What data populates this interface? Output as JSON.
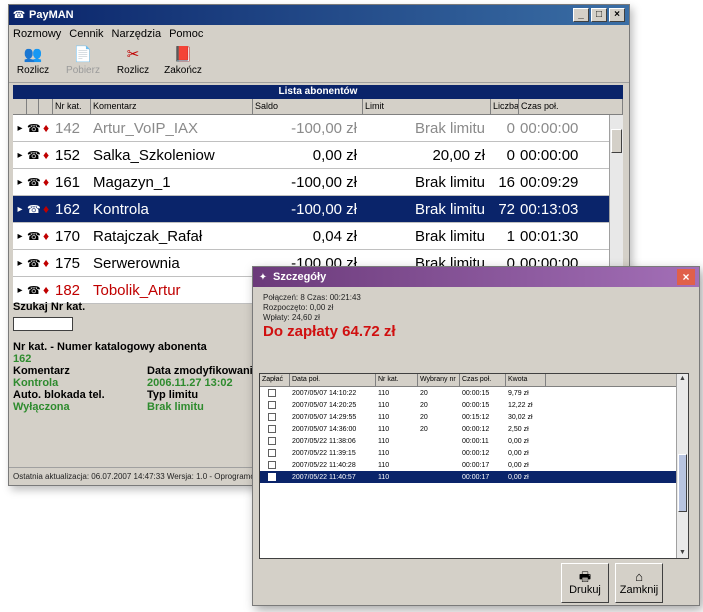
{
  "main": {
    "title": "PayMAN",
    "window_buttons": [
      "_",
      "□",
      "×"
    ],
    "menu": [
      "Rozmowy",
      "Cennik",
      "Narzędzia",
      "Pomoc"
    ],
    "toolbar": [
      {
        "icon": "users-icon",
        "glyph": "👥",
        "label": "Rozlicz",
        "disabled": false
      },
      {
        "icon": "doc-icon",
        "glyph": "📄",
        "label": "Pobierz",
        "disabled": true
      },
      {
        "icon": "calc-icon",
        "glyph": "✂",
        "label": "Rozlicz",
        "disabled": false
      },
      {
        "icon": "book-icon",
        "glyph": "📕",
        "label": "Zakończ",
        "disabled": false
      }
    ],
    "list_header": "Lista abonentów",
    "columns": [
      "",
      "",
      "",
      "Nr kat.",
      "Komentarz",
      "Saldo",
      "Limit",
      "Liczba poł.",
      "Czas poł."
    ],
    "rows": [
      {
        "mark": "▸",
        "num": "142",
        "name": "Artur_VoIP_IAX",
        "saldo": "-100,00 zł",
        "limit": "Brak limitu",
        "count": "0",
        "time": "00:00:00",
        "style": "gray",
        "selected": false
      },
      {
        "mark": "▸",
        "num": "152",
        "name": "Salka_Szkoleniow",
        "saldo": "0,00 zł",
        "limit": "20,00 zł",
        "count": "0",
        "time": "00:00:00",
        "style": "normal",
        "selected": false
      },
      {
        "mark": "▸",
        "num": "161",
        "name": "Magazyn_1",
        "saldo": "-100,00 zł",
        "limit": "Brak limitu",
        "count": "16",
        "time": "00:09:29",
        "style": "normal",
        "selected": false
      },
      {
        "mark": "▸",
        "num": "162",
        "name": "Kontrola",
        "saldo": "-100,00 zł",
        "limit": "Brak limitu",
        "count": "72",
        "time": "00:13:03",
        "style": "normal",
        "selected": true
      },
      {
        "mark": "▸",
        "num": "170",
        "name": "Ratajczak_Rafał",
        "saldo": "0,04 zł",
        "limit": "Brak limitu",
        "count": "1",
        "time": "00:01:30",
        "style": "normal",
        "selected": false
      },
      {
        "mark": "▸",
        "num": "175",
        "name": "Serwerownia",
        "saldo": "-100,00 zł",
        "limit": "Brak limitu",
        "count": "0",
        "time": "00:00:00",
        "style": "normal",
        "selected": false
      },
      {
        "mark": "▸",
        "num": "182",
        "name": "Tobolik_Artur",
        "saldo": "",
        "limit": "",
        "count": "",
        "time": "",
        "style": "red",
        "selected": false
      }
    ],
    "lower": {
      "search_label": "Szukaj Nr kat.",
      "nr_label": "Nr kat. - Numer katalogowy abonenta",
      "nr_value": "162",
      "comment_label": "Komentarz",
      "comment_value": "Kontrola",
      "date_label": "Data zmodyfikowania",
      "date_value": "2006.11.27 13:02",
      "block_label": "Auto. blokada tel.",
      "block_value": "Wyłączona",
      "type_label": "Typ limitu",
      "type_value": "Brak limitu"
    },
    "statusbar": "Ostatnia aktualizacja: 06.07.2007 14:47:33   Wersja: 1.0 - Oprogramowanie do rozliczania rozmów"
  },
  "dialog": {
    "title": "Szczegóły",
    "info": [
      "Połączeń: 8  Czas: 00:21:43",
      "Rozpoczęto: 0,00 zł",
      "Wpłaty: 24,60 zł"
    ],
    "to_pay": "Do zapłaty 64.72 zł",
    "columns": [
      "Zapłać",
      "Data poł.",
      "Nr kat.",
      "Wybrany nr",
      "Czas poł.",
      "Kwota"
    ],
    "rows": [
      {
        "date": "2007/05/07 14:10:22",
        "nr": "110",
        "dest": "20",
        "dur": "00:00:15",
        "amt": "9,79 zł",
        "selected": false
      },
      {
        "date": "2007/05/07 14:20:25",
        "nr": "110",
        "dest": "20",
        "dur": "00:00:15",
        "amt": "12,22 zł",
        "selected": false
      },
      {
        "date": "2007/05/07 14:29:55",
        "nr": "110",
        "dest": "20",
        "dur": "00:15:12",
        "amt": "30,02 zł",
        "selected": false
      },
      {
        "date": "2007/05/07 14:36:00",
        "nr": "110",
        "dest": "20",
        "dur": "00:00:12",
        "amt": "2,50 zł",
        "selected": false
      },
      {
        "date": "2007/05/22 11:38:06",
        "nr": "110",
        "dest": "",
        "dur": "00:00:11",
        "amt": "0,00 zł",
        "selected": false
      },
      {
        "date": "2007/05/22 11:39:15",
        "nr": "110",
        "dest": "",
        "dur": "00:00:12",
        "amt": "0,00 zł",
        "selected": false
      },
      {
        "date": "2007/05/22 11:40:28",
        "nr": "110",
        "dest": "",
        "dur": "00:00:17",
        "amt": "0,00 zł",
        "selected": false
      },
      {
        "date": "2007/05/22 11:40:57",
        "nr": "110",
        "dest": "",
        "dur": "00:00:17",
        "amt": "0,00 zł",
        "selected": true
      }
    ],
    "print_label": "Drukuj",
    "close_label": "Zamknij"
  },
  "colors": {
    "title_blue": "#0a246a",
    "dialog_title": "#6b3a7a",
    "accent_red": "#d01010",
    "green": "#2e8b2e"
  }
}
